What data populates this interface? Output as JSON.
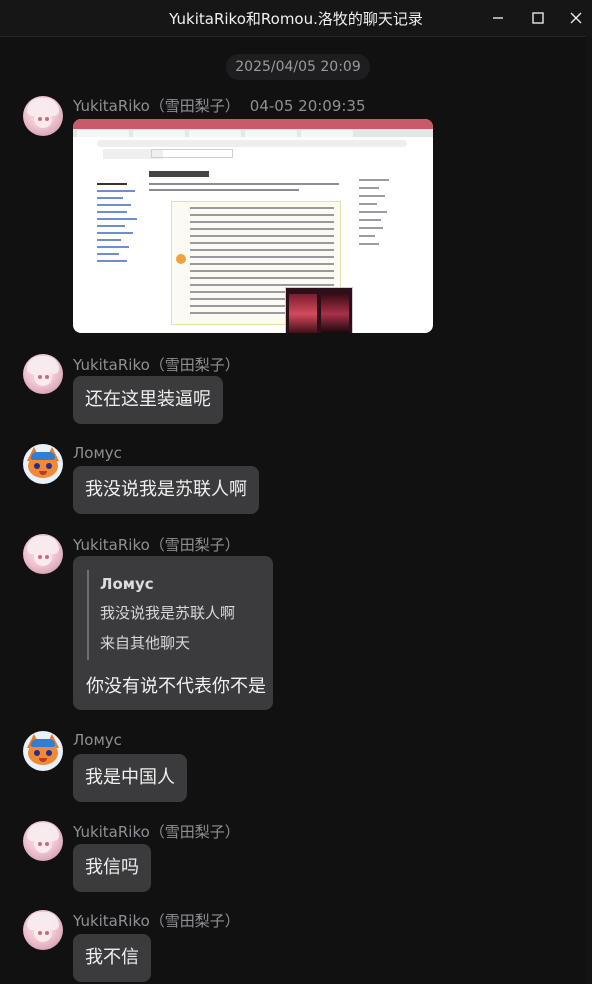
{
  "window": {
    "title": "YukitaRiko和Romou.洛牧的聊天记录",
    "minimize_icon": "minimize-icon",
    "maximize_icon": "maximize-icon",
    "close_icon": "close-icon"
  },
  "date_divider": "2025/04/05 20:09",
  "messages": [
    {
      "sender": "YukitaRiko（雪田梨子）",
      "time": "04-05 20:09:35",
      "type": "image",
      "avatar": "yukita-avatar"
    },
    {
      "sender": "YukitaRiko（雪田梨子）",
      "type": "text",
      "text": "还在这里装逼呢",
      "avatar": "yukita-avatar"
    },
    {
      "sender": "Ломус",
      "type": "text",
      "text": "我没说我是苏联人啊",
      "avatar": "lomus-avatar"
    },
    {
      "sender": "YukitaRiko（雪田梨子）",
      "type": "quote",
      "quote": {
        "name": "Ломус",
        "text": "我没说我是苏联人啊",
        "source": "来自其他聊天"
      },
      "text": "你没有说不代表你不是",
      "avatar": "yukita-avatar"
    },
    {
      "sender": "Ломус",
      "type": "text",
      "text": "我是中国人",
      "avatar": "lomus-avatar"
    },
    {
      "sender": "YukitaRiko（雪田梨子）",
      "type": "text",
      "text": "我信吗",
      "avatar": "yukita-avatar"
    },
    {
      "sender": "YukitaRiko（雪田梨子）",
      "type": "text",
      "text": "我不信",
      "avatar": "yukita-avatar"
    }
  ],
  "colors": {
    "background": "#111112",
    "bubble": "#3b3b3e",
    "sender_text": "#8f8f95",
    "message_text": "#f0f0f0"
  }
}
